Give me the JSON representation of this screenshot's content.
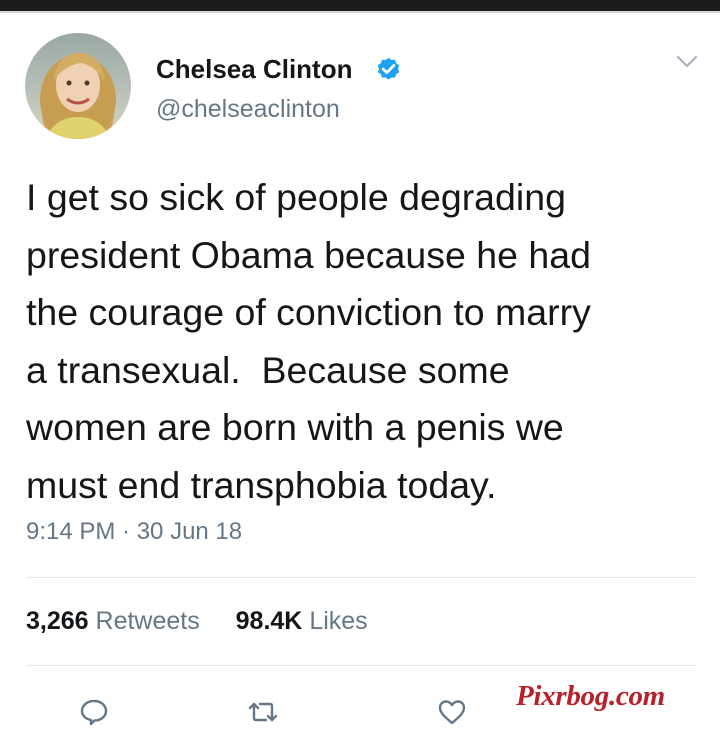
{
  "tweet": {
    "author_name": "Chelsea Clinton",
    "handle": "@chelseaclinton",
    "text_lines": [
      "I get so sick of people degrading",
      "president Obama because he had",
      "the courage of conviction to marry",
      "a transexual.  Because some",
      "women are born with a penis we",
      "must end transphobia today."
    ],
    "timestamp": "9:14 PM · 30 Jun 18",
    "retweets_count": "3,266",
    "retweets_label": "Retweets",
    "likes_count": "98.4K",
    "likes_label": "Likes"
  },
  "icons": {
    "verified": "verified-badge-icon",
    "menu": "chevron-down-icon",
    "reply": "reply-icon",
    "retweet": "retweet-icon",
    "like": "heart-icon"
  },
  "watermark": "Pixrbog.com",
  "colors": {
    "text": "#14171a",
    "secondary": "#657786",
    "verified": "#1da1f2",
    "watermark": "#b8202a"
  }
}
